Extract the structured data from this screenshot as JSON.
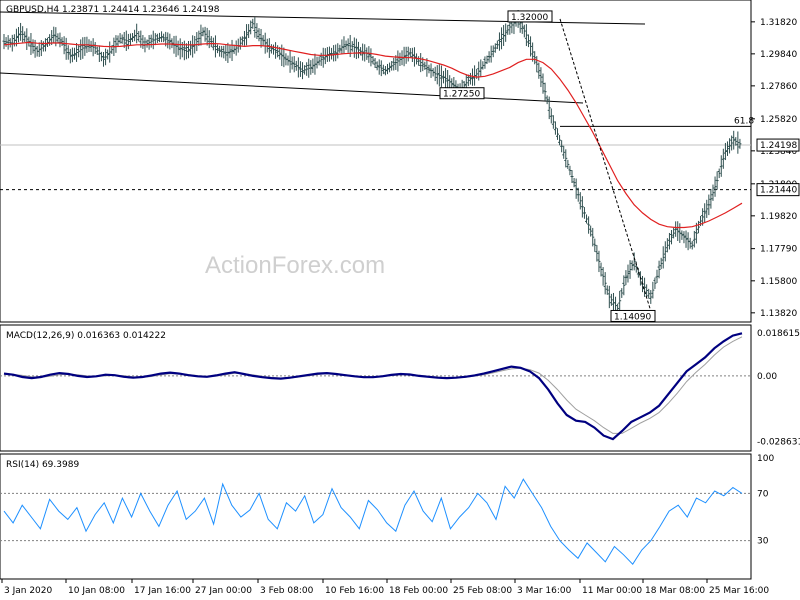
{
  "chart_data": [
    {
      "panel": "price",
      "type": "candlestick",
      "title": "GBPUSD,H4  1.23871 1.24414 1.23646 1.24198",
      "y_ticks": [
        "1.31820",
        "1.29840",
        "1.27860",
        "1.25820",
        "1.23840",
        "1.21800",
        "1.19820",
        "1.17790",
        "1.15800",
        "1.13820"
      ],
      "ylim": [
        1.135,
        1.328
      ],
      "current_price": "1.24198",
      "level_line": "1.21440",
      "fib_label": "61.8",
      "fib_level": 1.2535,
      "annotations": [
        {
          "text": "1.32000",
          "value": 1.32
        },
        {
          "text": "1.27250",
          "value": 1.2725
        },
        {
          "text": "1.14090",
          "value": 1.1409
        }
      ],
      "watermark": "ActionForex.com",
      "close_path": [
        1.306,
        1.305,
        1.312,
        1.306,
        1.3,
        1.304,
        1.31,
        1.306,
        1.297,
        1.3,
        1.304,
        1.302,
        1.295,
        1.301,
        1.308,
        1.306,
        1.311,
        1.304,
        1.307,
        1.309,
        1.306,
        1.302,
        1.3,
        1.304,
        1.312,
        1.306,
        1.3,
        1.299,
        1.302,
        1.308,
        1.317,
        1.308,
        1.302,
        1.3,
        1.295,
        1.292,
        1.288,
        1.29,
        1.294,
        1.298,
        1.299,
        1.304,
        1.303,
        1.3,
        1.298,
        1.291,
        1.288,
        1.292,
        1.296,
        1.299,
        1.294,
        1.29,
        1.286,
        1.284,
        1.28,
        1.276,
        1.282,
        1.286,
        1.293,
        1.3,
        1.308,
        1.315,
        1.32,
        1.31,
        1.296,
        1.28,
        1.26,
        1.245,
        1.23,
        1.215,
        1.2,
        1.185,
        1.165,
        1.148,
        1.1409,
        1.16,
        1.17,
        1.156,
        1.148,
        1.165,
        1.18,
        1.19,
        1.185,
        1.18,
        1.195,
        1.205,
        1.22,
        1.238,
        1.245,
        1.242
      ],
      "ma_path": [
        1.304,
        1.3045,
        1.305,
        1.3055,
        1.305,
        1.3048,
        1.3052,
        1.305,
        1.3045,
        1.304,
        1.304,
        1.3035,
        1.303,
        1.3028,
        1.303,
        1.3035,
        1.304,
        1.304,
        1.3042,
        1.3045,
        1.3045,
        1.3042,
        1.304,
        1.304,
        1.3045,
        1.3048,
        1.3046,
        1.304,
        1.3035,
        1.303,
        1.3035,
        1.3035,
        1.303,
        1.302,
        1.301,
        1.3,
        1.299,
        1.298,
        1.2975,
        1.2975,
        1.298,
        1.2985,
        1.2988,
        1.299,
        1.2988,
        1.298,
        1.297,
        1.2965,
        1.2962,
        1.296,
        1.2955,
        1.2945,
        1.293,
        1.2915,
        1.2895,
        1.287,
        1.285,
        1.284,
        1.2845,
        1.286,
        1.288,
        1.29,
        1.293,
        1.295,
        1.295,
        1.293,
        1.289,
        1.283,
        1.276,
        1.268,
        1.259,
        1.25,
        1.24,
        1.23,
        1.22,
        1.212,
        1.205,
        1.2,
        1.196,
        1.193,
        1.1915,
        1.191,
        1.191,
        1.1915,
        1.193,
        1.195,
        1.1975,
        1.2,
        1.203,
        1.206
      ]
    },
    {
      "panel": "macd",
      "type": "line",
      "title": "MACD(12,26,9) 0.016363 0.014222",
      "y_ticks": [
        "0.018615",
        "0.00",
        "-0.028631"
      ],
      "ylim": [
        -0.0305,
        0.0195
      ],
      "main_path": [
        0.001,
        0.0005,
        -0.0005,
        -0.001,
        -0.0005,
        0.0005,
        0.0012,
        0.0008,
        0.0,
        -0.0005,
        -0.0002,
        0.0005,
        0.0003,
        -0.0004,
        -0.0008,
        -0.0005,
        0.0002,
        0.001,
        0.0014,
        0.001,
        0.0003,
        -0.0002,
        -0.0004,
        0.0002,
        0.001,
        0.0016,
        0.0008,
        0.0,
        -0.0006,
        -0.001,
        -0.0012,
        -0.0008,
        -0.0002,
        0.0004,
        0.001,
        0.0012,
        0.0008,
        0.0003,
        -0.0002,
        -0.0006,
        -0.0006,
        -0.0002,
        0.0004,
        0.0008,
        0.0006,
        0.0,
        -0.0004,
        -0.0008,
        -0.001,
        -0.0008,
        -0.0004,
        0.0002,
        0.001,
        0.002,
        0.003,
        0.004,
        0.0035,
        0.002,
        -0.001,
        -0.006,
        -0.012,
        -0.017,
        -0.0195,
        -0.02,
        -0.0225,
        -0.026,
        -0.0275,
        -0.024,
        -0.02,
        -0.018,
        -0.016,
        -0.013,
        -0.008,
        -0.003,
        0.002,
        0.005,
        0.008,
        0.012,
        0.015,
        0.0175,
        0.0185
      ],
      "signal_path": [
        0.0008,
        0.0006,
        0.0002,
        -0.0004,
        -0.0006,
        -0.0002,
        0.0005,
        0.0008,
        0.0005,
        0.0,
        -0.0003,
        0.0,
        0.0003,
        0.0001,
        -0.0004,
        -0.0006,
        -0.0003,
        0.0004,
        0.0009,
        0.001,
        0.0006,
        0.0001,
        -0.0002,
        -0.0001,
        0.0005,
        0.0011,
        0.001,
        0.0004,
        -0.0002,
        -0.0007,
        -0.001,
        -0.0009,
        -0.0005,
        0.0,
        0.0006,
        0.0009,
        0.0009,
        0.0005,
        0.0,
        -0.0004,
        -0.0005,
        -0.0003,
        0.0001,
        0.0005,
        0.0006,
        0.0003,
        -0.0001,
        -0.0005,
        -0.0008,
        -0.0008,
        -0.0006,
        -0.0001,
        0.0005,
        0.0013,
        0.0022,
        0.003,
        0.0033,
        0.0027,
        0.0012,
        -0.002,
        -0.006,
        -0.0105,
        -0.0145,
        -0.017,
        -0.0195,
        -0.0225,
        -0.025,
        -0.025,
        -0.0228,
        -0.0205,
        -0.0185,
        -0.016,
        -0.012,
        -0.0075,
        -0.0025,
        0.0015,
        0.005,
        0.009,
        0.0125,
        0.015,
        0.017
      ]
    },
    {
      "panel": "rsi",
      "type": "line",
      "title": "RSI(14) 69.3989",
      "y_ticks": [
        "100",
        "70",
        "30",
        "0"
      ],
      "ylim": [
        0,
        100
      ],
      "levels": [
        70,
        30
      ],
      "rsi_path": [
        55,
        45,
        60,
        50,
        40,
        65,
        55,
        48,
        58,
        38,
        52,
        62,
        45,
        66,
        50,
        70,
        55,
        42,
        60,
        72,
        48,
        55,
        66,
        44,
        78,
        60,
        50,
        56,
        70,
        48,
        40,
        62,
        55,
        68,
        45,
        52,
        74,
        58,
        50,
        40,
        64,
        56,
        45,
        38,
        60,
        72,
        55,
        46,
        66,
        40,
        50,
        58,
        70,
        62,
        48,
        76,
        66,
        82,
        70,
        58,
        42,
        30,
        22,
        15,
        28,
        20,
        12,
        25,
        18,
        10,
        22,
        30,
        42,
        55,
        60,
        50,
        66,
        62,
        72,
        68,
        75,
        70
      ]
    }
  ],
  "x_labels": [
    "3 Jan 2020",
    "10 Jan 08:00",
    "17 Jan 16:00",
    "27 Jan 00:00",
    "3 Feb 08:00",
    "10 Feb 16:00",
    "18 Feb 00:00",
    "25 Feb 08:00",
    "3 Mar 16:00",
    "11 Mar 00:00",
    "18 Mar 08:00",
    "25 Mar 16:00"
  ],
  "colors": {
    "price_bars": "#2f4f4f",
    "ma": "#e02020",
    "macd_main": "#000080",
    "macd_signal": "#a0a0a0",
    "rsi": "#1e90ff",
    "grid_dotted": "#808080"
  }
}
